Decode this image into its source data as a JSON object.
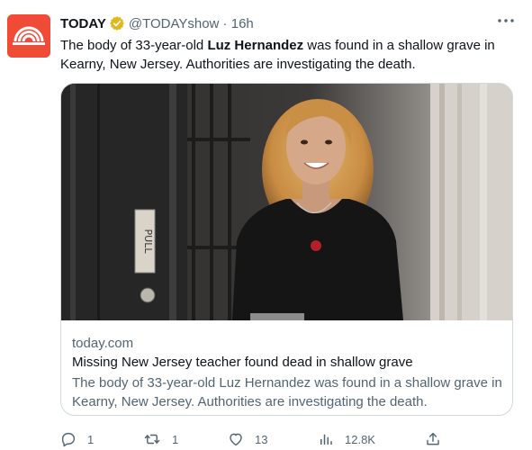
{
  "tweet": {
    "author_name": "TODAY",
    "handle_time": "@TODAYshow · 16h",
    "text_before": "The body of 33-year-old ",
    "text_bold": "Luz Hernandez",
    "text_after": " was found in a shallow grave in Kearny, New Jersey. Authorities are investigating the death."
  },
  "card": {
    "image_sign_text": "PULL",
    "domain": "today.com",
    "title": "Missing New Jersey teacher found dead in shallow grave",
    "description": "The body of 33-year-old Luz Hernandez was found in a shallow grave in Kearny, New Jersey. Authorities are investigating the death."
  },
  "actions": {
    "replies": "1",
    "reposts": "1",
    "likes": "13",
    "views": "12.8K"
  },
  "colors": {
    "avatar_bg": "#ef4b37",
    "verified_badge": "#e2b719",
    "secondary_text": "#536471",
    "border": "#cfd9de"
  }
}
